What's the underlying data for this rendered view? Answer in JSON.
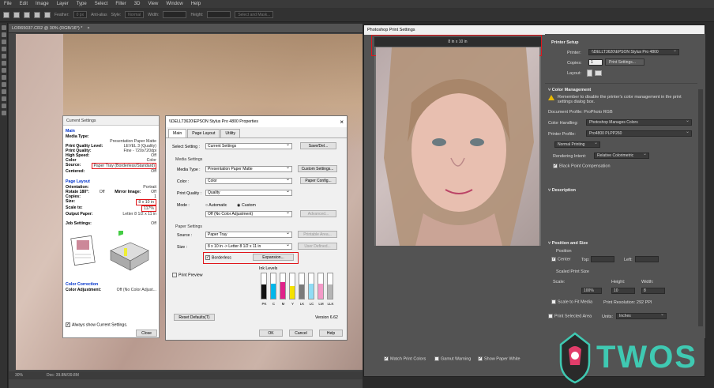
{
  "menu": [
    "File",
    "Edit",
    "Image",
    "Layer",
    "Type",
    "Select",
    "Filter",
    "3D",
    "View",
    "Window",
    "Help"
  ],
  "options": {
    "style_label": "Style:",
    "style_val": "Normal",
    "width_label": "Width:",
    "height_label": "Height:",
    "feather_label": "Feather:",
    "feather_val": "0 px",
    "antialias": "Anti-alias",
    "select_mask": "Select and Mask..."
  },
  "doc": {
    "tab": "LOR65037.CR2 @ 30% (RGB/16*) *",
    "zoom": "30%",
    "doc_size": "Doc: 39.8M/39.8M"
  },
  "current": {
    "title": "Current Settings",
    "main": "Main",
    "media_type_l": "Media Type:",
    "media_type_v": "Presentation Paper Matte",
    "pq_level_l": "Print Quality Level:",
    "pq_level_v": "LEVEL 3 (Quality)",
    "pq_l": "Print Quality:",
    "pq_v": "Fine - 720x720dpi",
    "hs_l": "High Speed:",
    "hs_v": "Off",
    "color_l": "Color",
    "color_v": "Color",
    "source_l": "Source:",
    "source_v": "Paper Tray (Borderless/Standard)",
    "centered_l": "Centered:",
    "centered_v": "Off",
    "page_layout": "Page Layout",
    "orient_l": "Orientation:",
    "orient_v": "Portrait",
    "rotate_l": "Rotate 180°:",
    "rotate_v": "Off",
    "mirror_l": "Mirror Image:",
    "mirror_v": "Off",
    "copies_l": "Copies:",
    "copies_v": "1",
    "size_l": "Size:",
    "size_v": "8 x 10 in",
    "scale_l": "Scale to:",
    "scale_v": "117%",
    "out_l": "Output Paper:",
    "out_v": "Letter 8 1/2 x 11 in",
    "job_l": "Job Settings:",
    "job_v": "Off",
    "cc": "Color Correction",
    "ca_l": "Color Adjustment:",
    "ca_v": "Off (No Color Adjust...",
    "always": "Always show Current Settings.",
    "close": "Close"
  },
  "epson": {
    "title": "\\\\DELLT3620\\EPSON Stylus Pro 4800 Properties",
    "tabs": [
      "Main",
      "Page Layout",
      "Utility"
    ],
    "select_setting_l": "Select Setting :",
    "select_setting_v": "Current Settings",
    "save_del": "Save/Del...",
    "media_settings": "Media Settings",
    "media_type_l": "Media Type :",
    "media_type_v": "Presentation Paper Matte",
    "custom_settings": "Custom Settings...",
    "color_l": "Color :",
    "color_v": "Color",
    "paper_config": "Paper Config...",
    "pq_l": "Print Quality :",
    "pq_v": "Quality",
    "mode_l": "Mode :",
    "mode_auto": "Automatic",
    "mode_custom": "Custom",
    "mode_sel": "Off (No Color Adjustment)",
    "advanced": "Advanced...",
    "paper_settings": "Paper Settings",
    "source_l": "Source :",
    "source_v": "Paper Tray",
    "printable_area": "Printable Area...",
    "size_l": "Size :",
    "size_v": "8 x 10 in -> Letter 8 1/2 x 11 in",
    "user_defined": "User Defined...",
    "borderless": "Borderless",
    "expansion": "Expansion...",
    "print_preview": "Print Preview",
    "ink_levels": "Ink Levels",
    "inks": [
      "PK",
      "C",
      "M",
      "Y",
      "LK",
      "LC",
      "LM",
      "LLK"
    ],
    "ink_colors": [
      "#111111",
      "#00b7eb",
      "#e0218a",
      "#f5e200",
      "#7a7a7a",
      "#8fdcf5",
      "#f49ac8",
      "#b5b5b5"
    ],
    "ink_levels_pct": [
      0.55,
      0.6,
      0.65,
      0.5,
      0.55,
      0.6,
      0.6,
      0.55
    ],
    "reset": "Reset Defaults(T)",
    "version": "Version 6.62",
    "ok": "OK",
    "cancel": "Cancel",
    "help": "Help"
  },
  "pps": {
    "title": "Photoshop Print Settings",
    "size_label": "8 in x 10 in",
    "printer_setup": "Printer Setup",
    "printer_l": "Printer:",
    "printer_v": "\\\\DELLT3620\\EPSON Stylus Pro 4800",
    "copies_l": "Copies:",
    "copies_v": "1",
    "print_settings": "Print Settings...",
    "layout_l": "Layout:",
    "color_mgmt": "Color Management",
    "cm_note": "Remember to disable the printer's color management in the print settings dialog box.",
    "doc_profile": "Document Profile: ProPhoto RGB",
    "handling_l": "Color Handling:",
    "handling_v": "Photoshop Manages Colors",
    "profile_l": "Printer Profile:",
    "profile_v": "Pro4800 PLPP260",
    "normal": "Normal Printing",
    "intent_l": "Rendering Intent:",
    "intent_v": "Relative Colorimetric",
    "bpc": "Black Point Compensation",
    "description": "Description",
    "pos_size": "Position and Size",
    "position": "Position",
    "center": "Center",
    "top_l": "Top:",
    "left_l": "Left:",
    "scaled": "Scaled Print Size",
    "scale_l": "Scale:",
    "height_l": "Height:",
    "width_l": "Width:",
    "scale_v": "100%",
    "height_v": "10",
    "width_v": "8",
    "fit": "Scale to Fit Media",
    "res": "Print Resolution: 292 PPI",
    "psa": "Print Selected Area",
    "units_l": "Units:",
    "units_v": "Inches",
    "match": "Match Print Colors",
    "gamut": "Gamut Warning",
    "paper_white": "Show Paper White"
  },
  "watermark": {
    "text": "TWOS",
    "color": "#3fc9b2"
  }
}
